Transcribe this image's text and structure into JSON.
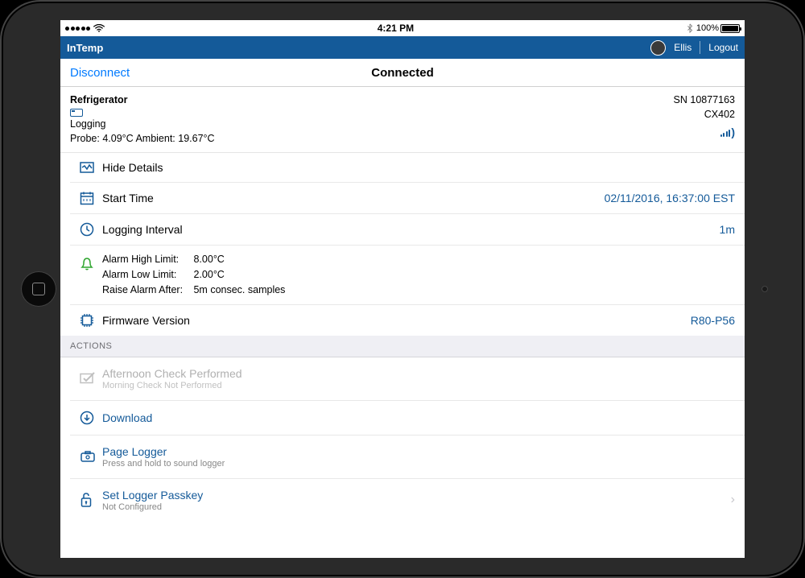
{
  "statusBar": {
    "time": "4:21 PM",
    "battery": "100%"
  },
  "appBar": {
    "title": "InTemp",
    "user": "Ellis",
    "logout": "Logout"
  },
  "nav": {
    "back": "Disconnect",
    "title": "Connected"
  },
  "device": {
    "name": "Refrigerator",
    "status": "Logging",
    "probeLabel": "Probe: ",
    "probeValue": "4.09°C",
    "ambientLabel": " Ambient: ",
    "ambientValue": "19.67°C",
    "serial": "SN 10877163",
    "model": "CX402"
  },
  "details": {
    "hideLabel": "Hide Details",
    "startTimeLabel": "Start Time",
    "startTimeValue": "02/11/2016, 16:37:00 EST",
    "intervalLabel": "Logging Interval",
    "intervalValue": "1m",
    "alarmHighLabel": "Alarm High Limit:",
    "alarmHighValue": "8.00°C",
    "alarmLowLabel": "Alarm Low Limit:",
    "alarmLowValue": "2.00°C",
    "raiseAfterLabel": "Raise Alarm After:",
    "raiseAfterValue": "5m consec. samples",
    "firmwareLabel": "Firmware Version",
    "firmwareValue": "R80-P56"
  },
  "actionsHeader": "ACTIONS",
  "actions": {
    "check": {
      "title": "Afternoon Check Performed",
      "subtitle": "Morning Check Not Performed"
    },
    "download": {
      "title": "Download"
    },
    "page": {
      "title": "Page Logger",
      "subtitle": "Press and hold to sound logger"
    },
    "passkey": {
      "title": "Set Logger Passkey",
      "subtitle": "Not Configured"
    }
  }
}
